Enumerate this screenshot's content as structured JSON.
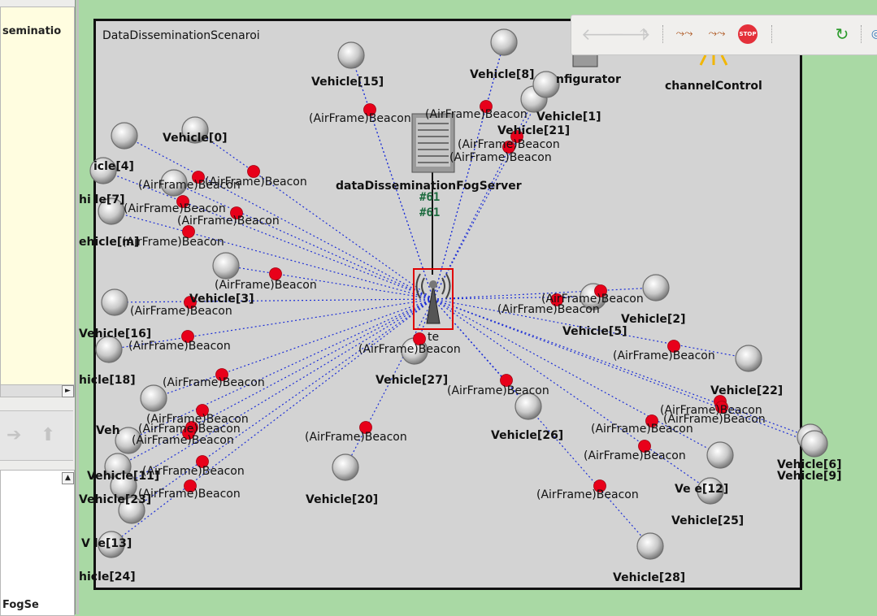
{
  "left_panel": {
    "top_text": "seminatio",
    "bottom_text": "FogSe",
    "hscroll_right": "►",
    "vscroll_up": "▲"
  },
  "toolbar": {
    "buttons": [
      "back",
      "forward",
      "up",
      "run",
      "fast-run",
      "stop",
      "refresh",
      "zoom"
    ],
    "stop_label": "STOP"
  },
  "scenario": {
    "title": "DataDisseminationScenaroi",
    "configurator_label": "nfigurator",
    "channel_control_label": "channelControl",
    "fog_server_label": "dataDisseminationFogServer",
    "link_label_1": "#61",
    "link_label_2": "#61",
    "rsu_label": "te"
  },
  "labels": [
    {
      "id": "v15",
      "text": "Vehicle[15]"
    },
    {
      "id": "v8",
      "text": "Vehicle[8]"
    },
    {
      "id": "v1",
      "text": "Vehicle[1]"
    },
    {
      "id": "v21",
      "text": "Vehicle[21]"
    },
    {
      "id": "v0",
      "text": "Vehicle[0]"
    },
    {
      "id": "v4",
      "text": "icle[4]"
    },
    {
      "id": "v7",
      "text": "hi le[7]"
    },
    {
      "id": "vm",
      "text": "ehicle[m]"
    },
    {
      "id": "v3",
      "text": "Vehicle[3]"
    },
    {
      "id": "v16",
      "text": "Vehicle[16]"
    },
    {
      "id": "v18",
      "text": "hicle[18]"
    },
    {
      "id": "v27",
      "text": "Vehicle[27]"
    },
    {
      "id": "v2",
      "text": "Vehicle[2]"
    },
    {
      "id": "v5",
      "text": "Vehicle[5]"
    },
    {
      "id": "v22",
      "text": "Vehicle[22]"
    },
    {
      "id": "v26",
      "text": "Vehicle[26]"
    },
    {
      "id": "v20",
      "text": "Vehicle[20]"
    },
    {
      "id": "v6",
      "text": "Vehicle[6]"
    },
    {
      "id": "v9",
      "text": "Vehicle[9]"
    },
    {
      "id": "v12",
      "text": "Ve   e[12]"
    },
    {
      "id": "v25",
      "text": "Vehicle[25]"
    },
    {
      "id": "v28",
      "text": "Vehicle[28]"
    },
    {
      "id": "v13",
      "text": "V   le[13]"
    },
    {
      "id": "v24",
      "text": "hicle[24]"
    },
    {
      "id": "v11",
      "text": "Vehicle[11]"
    },
    {
      "id": "v23",
      "text": "Vehicle[23]"
    },
    {
      "id": "v10",
      "text": "Veh"
    },
    {
      "id": "b1",
      "text": "(AirFrame)Beacon"
    },
    {
      "id": "b2",
      "text": "(AirFrame)Beacon"
    },
    {
      "id": "b3",
      "text": "(AirFrame)Beacon"
    },
    {
      "id": "b4",
      "text": "(AirFrame)Beacon"
    },
    {
      "id": "b5",
      "text": "(AirFrame)Beacon"
    },
    {
      "id": "b6",
      "text": "(AirFrame)Beacon"
    },
    {
      "id": "b7",
      "text": "(AirFrame)Beacon"
    },
    {
      "id": "b8",
      "text": "(AirFrame)Beacon"
    },
    {
      "id": "b9",
      "text": "(AirFrame)Beacon"
    },
    {
      "id": "b10",
      "text": "(AirFrame)Beacon"
    },
    {
      "id": "b11",
      "text": "(AirFrame)Beacon"
    },
    {
      "id": "b12",
      "text": "(AirFrame)Beacon"
    },
    {
      "id": "b13",
      "text": "(AirFrame)Beacon"
    },
    {
      "id": "b14",
      "text": "(AirFrame)Beacon"
    },
    {
      "id": "b15",
      "text": "(AirFrame)Beacon"
    },
    {
      "id": "b16",
      "text": "(AirFrame)Beacon"
    },
    {
      "id": "b17",
      "text": "(AirFrame)Beacon"
    },
    {
      "id": "b18",
      "text": "(AirFrame)Beacon"
    },
    {
      "id": "b19",
      "text": "(AirFrame)Beacon"
    },
    {
      "id": "b20",
      "text": "(AirFrame)Beacon"
    },
    {
      "id": "b21",
      "text": "(AirFrame)Beacon"
    },
    {
      "id": "b22",
      "text": "(AirFrame)Beacon"
    },
    {
      "id": "b23",
      "text": "(AirFrame)Beacon"
    },
    {
      "id": "b24",
      "text": "(AirFrame)Beacon"
    },
    {
      "id": "b25",
      "text": "(AirFrame)Beacon"
    },
    {
      "id": "b26",
      "text": "(AirFrame)Beacon"
    },
    {
      "id": "b27",
      "text": "(AirFrame)Beacon"
    },
    {
      "id": "b28",
      "text": "(AirFrame)Beacon"
    },
    {
      "id": "b29",
      "text": "(AirFrame)Beacon"
    }
  ],
  "colors": {
    "canvas_bg": "#d3d3d3",
    "window_bg": "#a9d9a4",
    "beacon_dot": "#e8001a",
    "link_line": "#1d2fd6",
    "vehicle_arrow": "#1a32d8",
    "selection_box": "#e00000"
  }
}
